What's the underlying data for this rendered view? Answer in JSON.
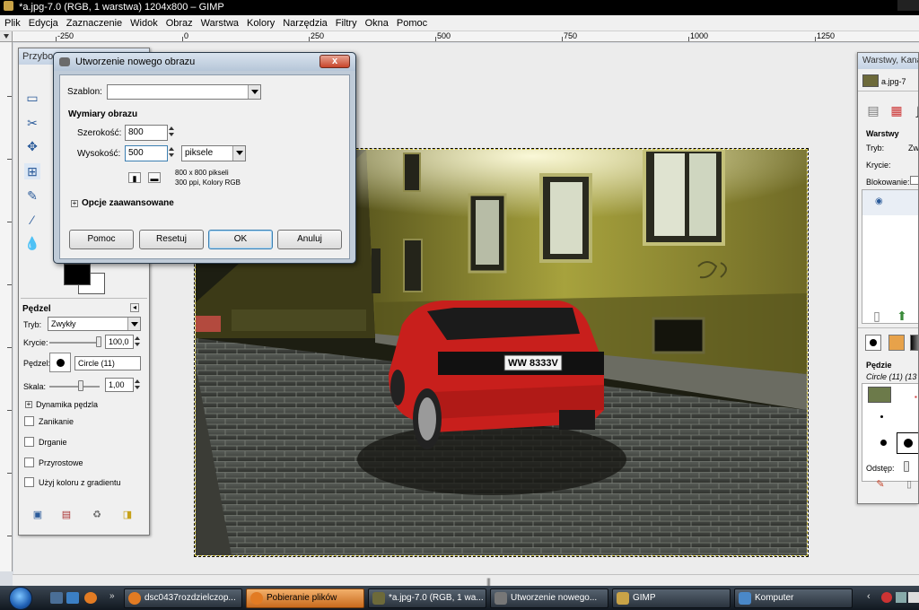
{
  "window": {
    "title": "*a.jpg-7.0 (RGB, 1 warstwa) 1204x800 – GIMP"
  },
  "menu": [
    "Plik",
    "Edycja",
    "Zaznaczenie",
    "Widok",
    "Obraz",
    "Warstwa",
    "Kolory",
    "Narzędzia",
    "Filtry",
    "Okna",
    "Pomoc"
  ],
  "rulers": {
    "h_labels": [
      "-250",
      "0",
      "250",
      "500",
      "750",
      "1000",
      "1250"
    ]
  },
  "toolbox": {
    "title": "Przybo",
    "panel_title": "Pędzel",
    "mode_label": "Tryb:",
    "mode_value": "Zwykły",
    "opacity_label": "Krycie:",
    "opacity_value": "100,0",
    "brush_label": "Pędzel:",
    "brush_value": "Circle (11)",
    "scale_label": "Skala:",
    "scale_value": "1,00",
    "dynamics_label": "Dynamika pędzla",
    "options": [
      "Zanikanie",
      "Drganie",
      "Przyrostowe",
      "Użyj koloru z gradientu"
    ]
  },
  "dialog": {
    "title": "Utworzenie nowego obrazu",
    "close_label": "x",
    "template_label": "Szablon:",
    "template_value": "",
    "section_title": "Wymiary obrazu",
    "width_label": "Szerokość:",
    "width_value": "800",
    "height_label": "Wysokość:",
    "height_value": "500",
    "unit_value": "piksele",
    "info_size": "800 x 800 pikseli",
    "info_res": "300 ppi, Kolory RGB",
    "advanced_label": "Opcje zaawansowane",
    "buttons": {
      "help": "Pomoc",
      "reset": "Resetuj",
      "ok": "OK",
      "cancel": "Anuluj"
    }
  },
  "layers_panel": {
    "title": "Warstwy, Kana",
    "image_name": "a.jpg-7",
    "section_title": "Warstwy",
    "mode_label": "Tryb:",
    "mode_value": "Zw",
    "opacity_label": "Krycie:",
    "lock_label": "Blokowanie:",
    "brushes_title": "Pędzie",
    "brush_name": "Circle (11) (13 ×",
    "spacing_label": "Odstęp:"
  },
  "photo": {
    "plate_text": "WW 8333V"
  },
  "taskbar": {
    "tasks": [
      "dsc0437rozdzielczop...",
      "Pobieranie plików",
      "*a.jpg-7.0 (RGB, 1 wa...",
      "Utworzenie nowego...",
      "GIMP",
      "Komputer"
    ]
  },
  "colors": {
    "accent": "#3c7fb1",
    "taskbar_active": "#e08a3a",
    "dialog_close": "#c7442a"
  }
}
